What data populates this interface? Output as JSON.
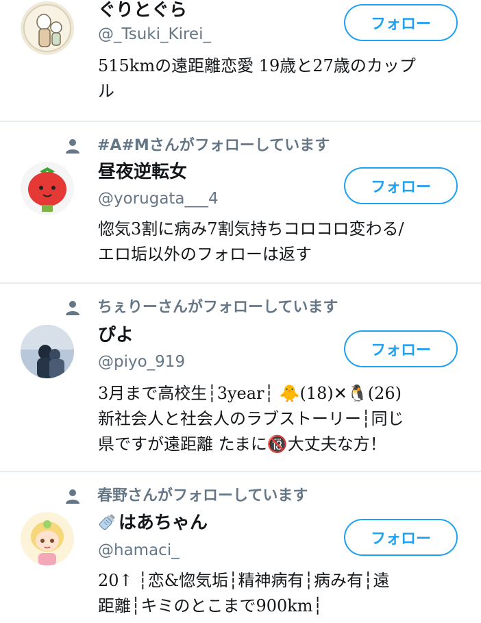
{
  "colors": {
    "accent": "#1da1f2",
    "muted": "#657786",
    "text": "#14171a",
    "divider": "#e6ecf0"
  },
  "follow_label": "フォロー",
  "users": [
    {
      "context": "",
      "name": "ぐりとぐら",
      "handle": "@_Tsuki_Kirei_",
      "bio_lines": [
        "515kmの遠距離恋愛 19歳と27歳のカップ",
        "ル"
      ]
    },
    {
      "context": "#A#Mさんがフォローしています",
      "name": "昼夜逆転女",
      "handle": "@yorugata___4",
      "bio_lines": [
        "惚気3割に病み7割気持ちコロコロ変わる/",
        "エロ垢以外のフォローは返す"
      ]
    },
    {
      "context": "ちぇりーさんがフォローしています",
      "name": "ぴよ",
      "handle": "@piyo_919",
      "bio_lines": [
        "3月まで高校生┆3year┆ 🐥(18)✕🐧(26)",
        "新社会人と社会人のラブストーリー┆同じ",
        "県ですが遠距離 たまに🔞大丈夫な方！"
      ]
    },
    {
      "context": "春野さんがフォローしています",
      "name": "はあちゃん",
      "name_prefix_icon": "baby-bottle-icon",
      "handle": "@hamaci_",
      "bio_lines": [
        "20↑ ┆恋&惚気垢┆精神病有┆病み有┆遠",
        "距離┆キミのとこまで900km┆"
      ]
    }
  ]
}
